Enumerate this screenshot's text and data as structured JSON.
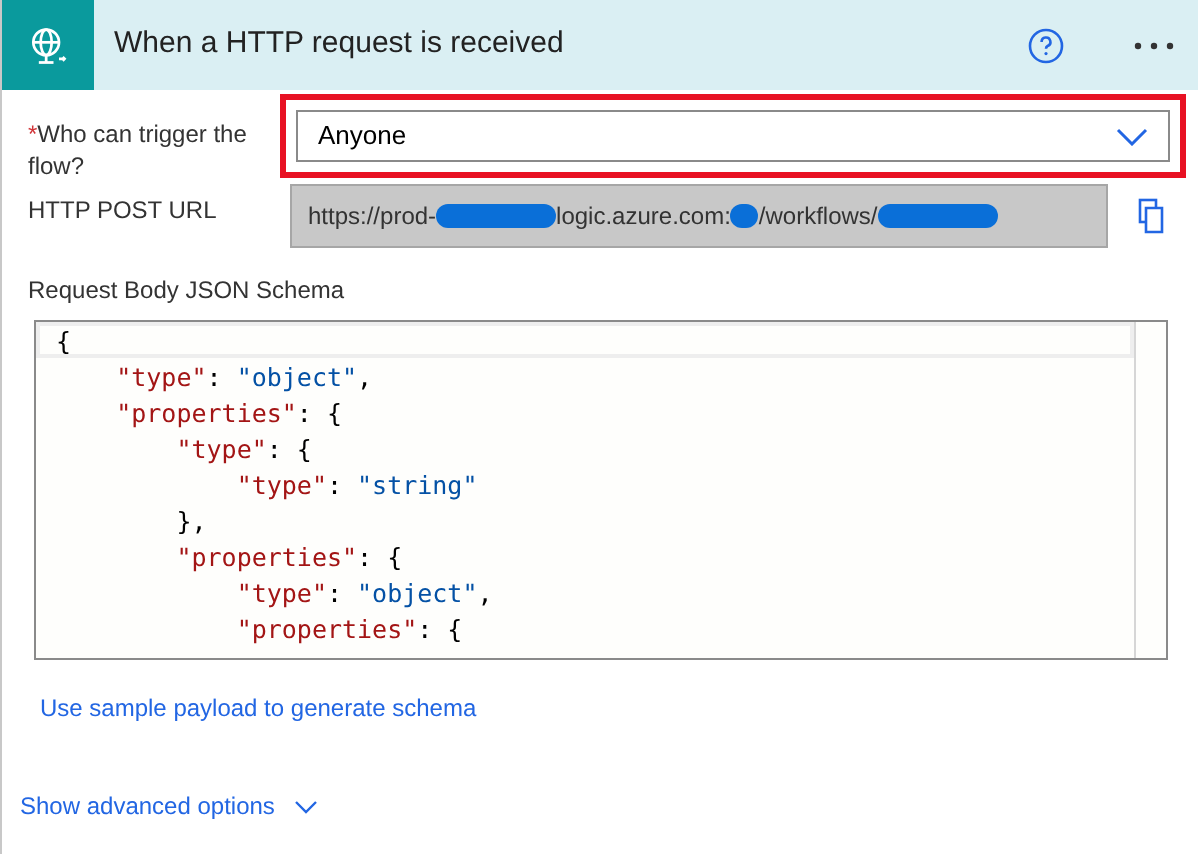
{
  "header": {
    "title": "When a HTTP request is received"
  },
  "who_can_trigger": {
    "required_mark": "*",
    "label": "Who can trigger the flow?",
    "value": "Anyone",
    "highlighted": true
  },
  "http_post_url": {
    "label": "HTTP POST URL",
    "segments": [
      "https://prod-",
      "logic.azure.com:",
      "/workflows/"
    ]
  },
  "schema": {
    "label": "Request Body JSON Schema",
    "lines": [
      "{",
      "    \"type\": \"object\",",
      "    \"properties\": {",
      "        \"type\": {",
      "            \"type\": \"string\"",
      "        },",
      "        \"properties\": {",
      "            \"type\": \"object\",",
      "            \"properties\": {"
    ]
  },
  "sample_payload_link": "Use sample payload to generate schema",
  "advanced_options": {
    "label": "Show advanced options",
    "expanded": false
  }
}
